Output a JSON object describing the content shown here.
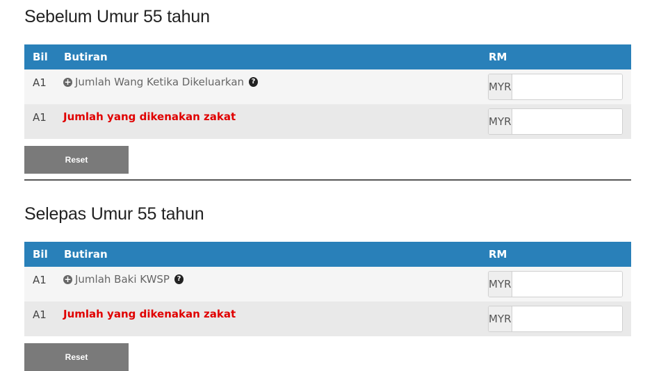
{
  "sections": [
    {
      "title": "Sebelum Umur 55 tahun",
      "headers": {
        "bil": "Bil",
        "butiran": "Butiran",
        "rm": "RM"
      },
      "rows": [
        {
          "bil": "A1",
          "label": "Jumlah Wang Ketika Dikeluarkan",
          "currency": "MYR",
          "value": ""
        },
        {
          "bil": "A1",
          "label": "Jumlah yang dikenakan zakat",
          "currency": "MYR",
          "value": ""
        }
      ],
      "reset_label": "Reset"
    },
    {
      "title": "Selepas Umur 55 tahun",
      "headers": {
        "bil": "Bil",
        "butiran": "Butiran",
        "rm": "RM"
      },
      "rows": [
        {
          "bil": "A1",
          "label": "Jumlah Baki KWSP",
          "currency": "MYR",
          "value": ""
        },
        {
          "bil": "A1",
          "label": "Jumlah yang dikenakan zakat",
          "currency": "MYR",
          "value": ""
        }
      ],
      "reset_label": "Reset"
    }
  ],
  "icons": {
    "expand": "plus-circle-icon",
    "help": "question-circle-icon",
    "spinner": "number-spinner-icon"
  },
  "colors": {
    "header_bg": "#2980b9",
    "highlight_text": "#e00000",
    "reset_bg": "#7a7a7a"
  }
}
